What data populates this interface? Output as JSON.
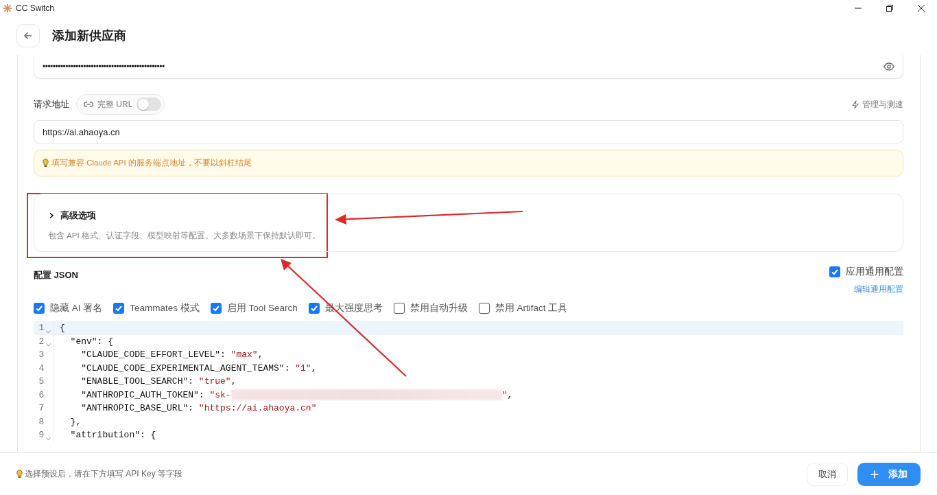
{
  "window": {
    "title": "CC Switch"
  },
  "header": {
    "title": "添加新供应商"
  },
  "api_key": {
    "value": "••••••••••••••••••••••••••••••••••••••••••••••••"
  },
  "request_url": {
    "label": "请求地址",
    "full_url_toggle": {
      "label": "完整 URL",
      "on": false
    },
    "manage_link": "管理与测速",
    "value": "https://ai.ahaoya.cn",
    "hint": "填写兼容 Claude API 的服务端点地址，不要以斜杠结尾"
  },
  "advanced": {
    "title": "高级选项",
    "expanded": false,
    "description": "包含 API 格式、认证字段、模型映射等配置。大多数场景下保持默认即可。"
  },
  "config_json": {
    "title": "配置 JSON",
    "apply_common": {
      "label": "应用通用配置",
      "checked": true
    },
    "edit_common_link": "编辑通用配置",
    "options": [
      {
        "label": "隐藏 AI 署名",
        "checked": true
      },
      {
        "label": "Teammates 模式",
        "checked": true
      },
      {
        "label": "启用 Tool Search",
        "checked": true
      },
      {
        "label": "最大强度思考",
        "checked": true
      },
      {
        "label": "禁用自动升级",
        "checked": false
      },
      {
        "label": "禁用 Artifact 工具",
        "checked": false
      }
    ],
    "lines": [
      {
        "number": "1",
        "foldable": true,
        "active": true,
        "parts": [
          {
            "kind": "plain",
            "text": "{"
          }
        ]
      },
      {
        "number": "2",
        "foldable": true,
        "active": false,
        "parts": [
          {
            "kind": "plain",
            "text": "  \"env\": {"
          }
        ]
      },
      {
        "number": "3",
        "foldable": false,
        "active": false,
        "parts": [
          {
            "kind": "plain",
            "text": "    \"CLAUDE_CODE_EFFORT_LEVEL\": "
          },
          {
            "kind": "string",
            "text": "\"max\""
          },
          {
            "kind": "plain",
            "text": ","
          }
        ]
      },
      {
        "number": "4",
        "foldable": false,
        "active": false,
        "parts": [
          {
            "kind": "plain",
            "text": "    \"CLAUDE_CODE_EXPERIMENTAL_AGENT_TEAMS\": "
          },
          {
            "kind": "string",
            "text": "\"1\""
          },
          {
            "kind": "plain",
            "text": ","
          }
        ]
      },
      {
        "number": "5",
        "foldable": false,
        "active": false,
        "parts": [
          {
            "kind": "plain",
            "text": "    \"ENABLE_TOOL_SEARCH\": "
          },
          {
            "kind": "string",
            "text": "\"true\""
          },
          {
            "kind": "plain",
            "text": ","
          }
        ]
      },
      {
        "number": "6",
        "foldable": false,
        "active": false,
        "parts": [
          {
            "kind": "plain",
            "text": "    \"ANTHROPIC_AUTH_TOKEN\": "
          },
          {
            "kind": "string",
            "text": "\"sk-"
          },
          {
            "kind": "redacted"
          },
          {
            "kind": "string",
            "text": "\""
          },
          {
            "kind": "plain",
            "text": ","
          }
        ]
      },
      {
        "number": "7",
        "foldable": false,
        "active": false,
        "parts": [
          {
            "kind": "plain",
            "text": "    \"ANTHROPIC_BASE_URL\": "
          },
          {
            "kind": "string",
            "text": "\"https://ai.ahaoya.cn\""
          }
        ]
      },
      {
        "number": "8",
        "foldable": false,
        "active": false,
        "parts": [
          {
            "kind": "plain",
            "text": "  },"
          }
        ]
      },
      {
        "number": "9",
        "foldable": true,
        "active": false,
        "parts": [
          {
            "kind": "plain",
            "text": "  \"attribution\": {"
          }
        ]
      }
    ]
  },
  "footer": {
    "hint": "选择预设后，请在下方填写 API Key 等字段",
    "cancel": "取消",
    "submit": "添加"
  }
}
